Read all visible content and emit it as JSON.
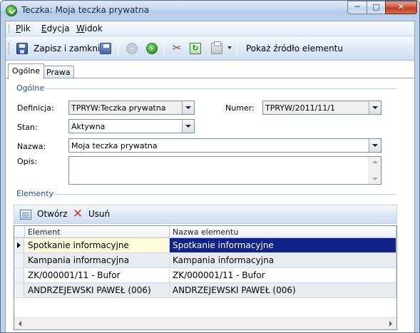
{
  "window": {
    "title": "Teczka: Moja teczka prywatna",
    "minimize": "─",
    "maximize": "□",
    "close": "✕"
  },
  "menu": {
    "items": [
      {
        "first": "P",
        "rest": "lik"
      },
      {
        "first": "E",
        "rest": "dycja"
      },
      {
        "first": "W",
        "rest": "idok"
      }
    ]
  },
  "toolbar": {
    "save_close_label": "Zapisz i zamknij",
    "show_source_label": "Pokaż źródło elementu",
    "back_glyph": "‹",
    "forward_glyph": "›",
    "tools_glyph": "✂",
    "refresh_glyph": "↻",
    "icons": [
      "save-icon",
      "save-as-icon",
      "back-arrow-icon",
      "forward-arrow-icon",
      "tools-icon",
      "refresh-icon",
      "print-icon"
    ]
  },
  "tabs": [
    {
      "label": "Ogólne",
      "active": true
    },
    {
      "label": "Prawa",
      "active": false
    }
  ],
  "general": {
    "section_title": "Ogólne",
    "definition_label": "Definicja:",
    "definition_value": "TPRYW:Teczka prywatna",
    "number_label": "Numer:",
    "number_value": "TPRYW/2011/11/1",
    "status_label": "Stan:",
    "status_value": "Aktywna",
    "name_label": "Nazwa:",
    "name_value": "Moja teczka prywatna",
    "desc_label": "Opis:",
    "desc_value": ""
  },
  "elements": {
    "section_title": "Elementy",
    "open_label": "Otwórz",
    "delete_label": "Usuń",
    "columns": [
      "Element",
      "Nazwa elementu"
    ],
    "rows": [
      {
        "element": "Spotkanie informacyjne",
        "name": "Spotkanie informacyjne",
        "selected": true
      },
      {
        "element": "Kampania informacyjna",
        "name": "Kampania informacyjna",
        "selected": false
      },
      {
        "element": "ZK/000001/11 - Bufor",
        "name": "ZK/000001/11 - Bufor",
        "selected": false
      },
      {
        "element": "ANDRZEJEWSKI PAWEŁ (006)",
        "name": "ANDRZEJEWSKI PAWEŁ (006)",
        "selected": false
      }
    ]
  },
  "colors": {
    "selection_bg": "#10238a",
    "selection_fg": "#ffffff",
    "current_cell_bg": "#fffbdc",
    "row_alt_bg": "#e8ebef",
    "section_title": "#1f4ea0"
  }
}
